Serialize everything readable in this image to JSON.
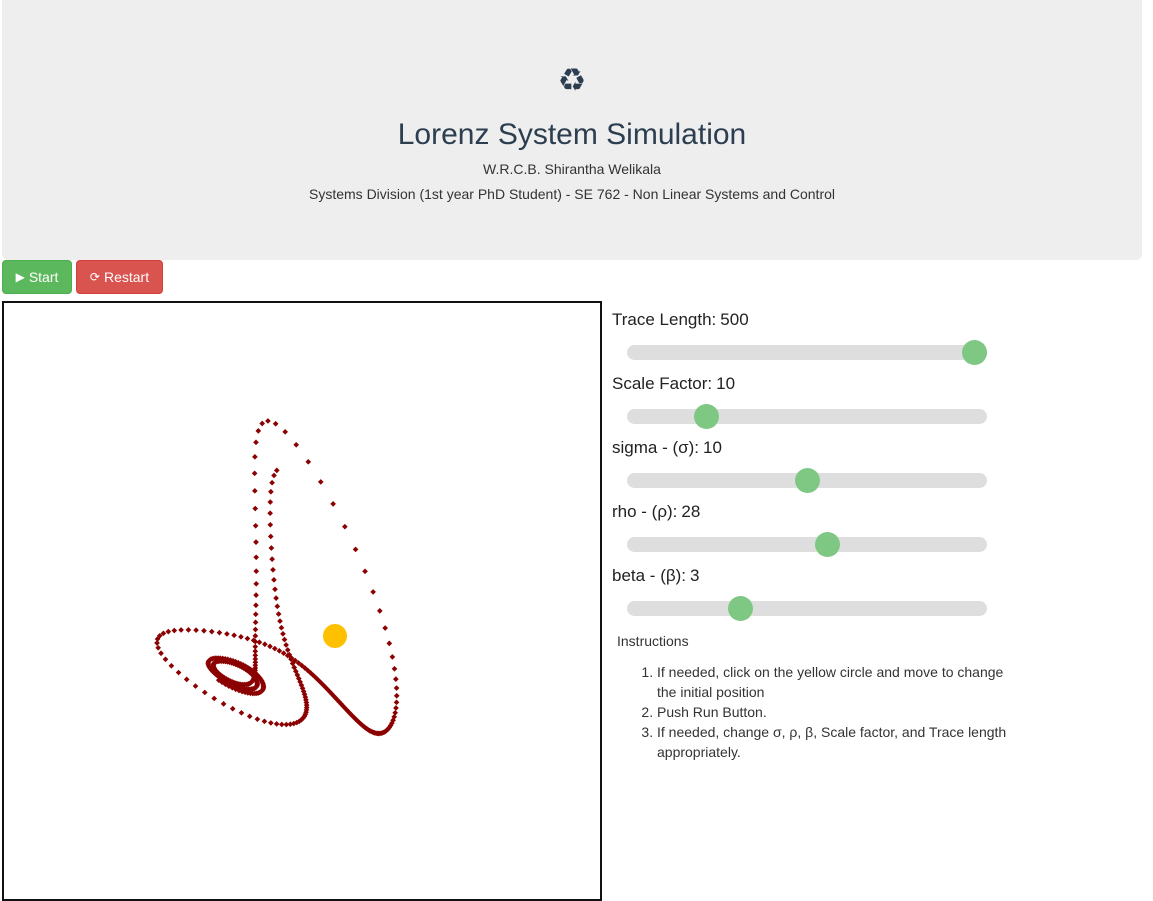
{
  "header": {
    "logo_icon": "recycle-icon",
    "logo_glyph": "♻",
    "title": "Lorenz System Simulation",
    "author": "W.R.C.B. Shirantha Welikala",
    "affiliation": "Systems Division (1st year PhD Student) - SE 762 - Non Linear Systems and Control"
  },
  "toolbar": {
    "start_icon": "play-icon",
    "start_label": "Start",
    "restart_icon": "refresh-icon",
    "restart_label": "Restart"
  },
  "controls": [
    {
      "label": "Trace Length:",
      "value": "500",
      "fraction": 0.965
    },
    {
      "label": "Scale Factor:",
      "value": "10",
      "fraction": 0.22
    },
    {
      "label": "sigma - (σ):",
      "value": "10",
      "fraction": 0.5
    },
    {
      "label": "rho - (ρ):",
      "value": "28",
      "fraction": 0.555
    },
    {
      "label": "beta - (β):",
      "value": "3",
      "fraction": 0.315
    }
  ],
  "instructions": {
    "title": "Instructions",
    "items": [
      "If needed, click on the yellow circle and move to change the initial position",
      "Push Run Button.",
      "If needed, change σ, ρ, β, Scale factor, and Trace length appropriately."
    ]
  },
  "colors": {
    "trace": "#8b0000",
    "initial_point": "#ffc000"
  }
}
